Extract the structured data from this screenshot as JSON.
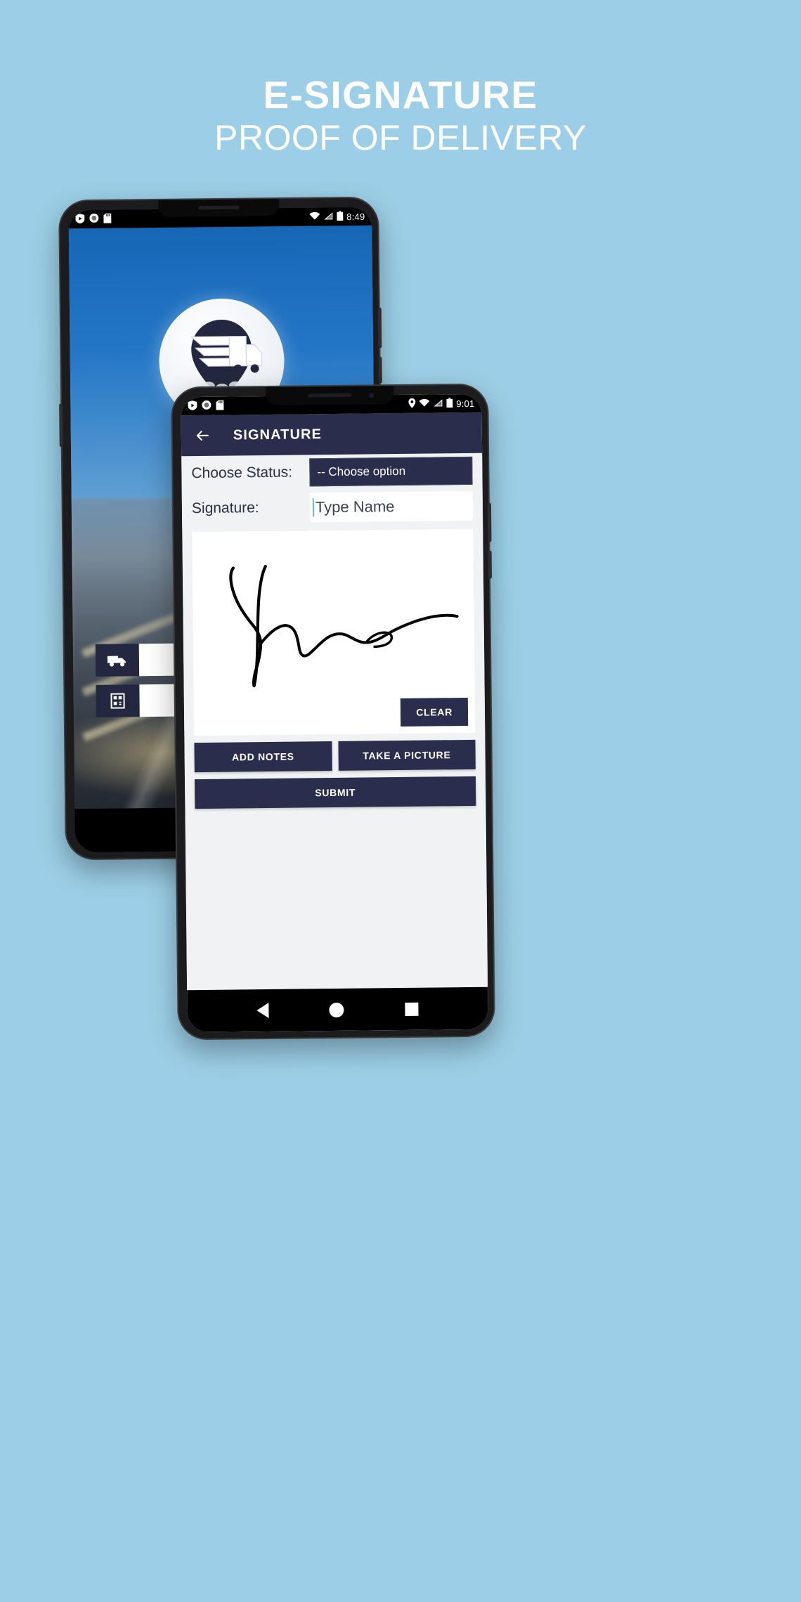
{
  "headline": {
    "line1": "E-SIGNATURE",
    "line2": "PROOF OF DELIVERY"
  },
  "colors": {
    "background": "#9ccfe7",
    "brand_navy": "#2a2e4c",
    "accent_caret": "#64c3b0",
    "text_light": "#ffffff"
  },
  "back_phone": {
    "status_bar": {
      "clock": "8:49",
      "icons_left": [
        "shield-play-icon",
        "record-icon",
        "sd-card-icon"
      ],
      "icons_right": [
        "wifi-icon",
        "signal-icon",
        "battery-icon"
      ]
    },
    "splash": {
      "logo_name": "winged-truck-pin-logo"
    },
    "tiles": [
      {
        "icon": "truck-icon"
      },
      {
        "icon": "barcode-scanner-icon"
      }
    ],
    "nav_bar": {
      "back": "back-triangle-icon"
    }
  },
  "front_phone": {
    "status_bar": {
      "clock": "9:01",
      "icons_left": [
        "shield-play-icon",
        "record-icon",
        "sd-card-icon"
      ],
      "icons_right": [
        "location-icon",
        "wifi-icon",
        "signal-icon",
        "battery-icon"
      ]
    },
    "app_bar": {
      "back_icon": "arrow-left-icon",
      "title": "SIGNATURE"
    },
    "form": {
      "status_label": "Choose Status:",
      "status_value": "-- Choose option",
      "signature_label": "Signature:",
      "signature_placeholder": "Type Name",
      "signature_value": ""
    },
    "canvas": {
      "clear_label": "CLEAR"
    },
    "buttons": {
      "add_notes": "ADD NOTES",
      "take_picture": "TAKE A PICTURE",
      "submit": "SUBMIT"
    },
    "nav_bar": {
      "back": "back-triangle-icon",
      "home": "home-circle-icon",
      "recents": "recents-square-icon"
    }
  }
}
